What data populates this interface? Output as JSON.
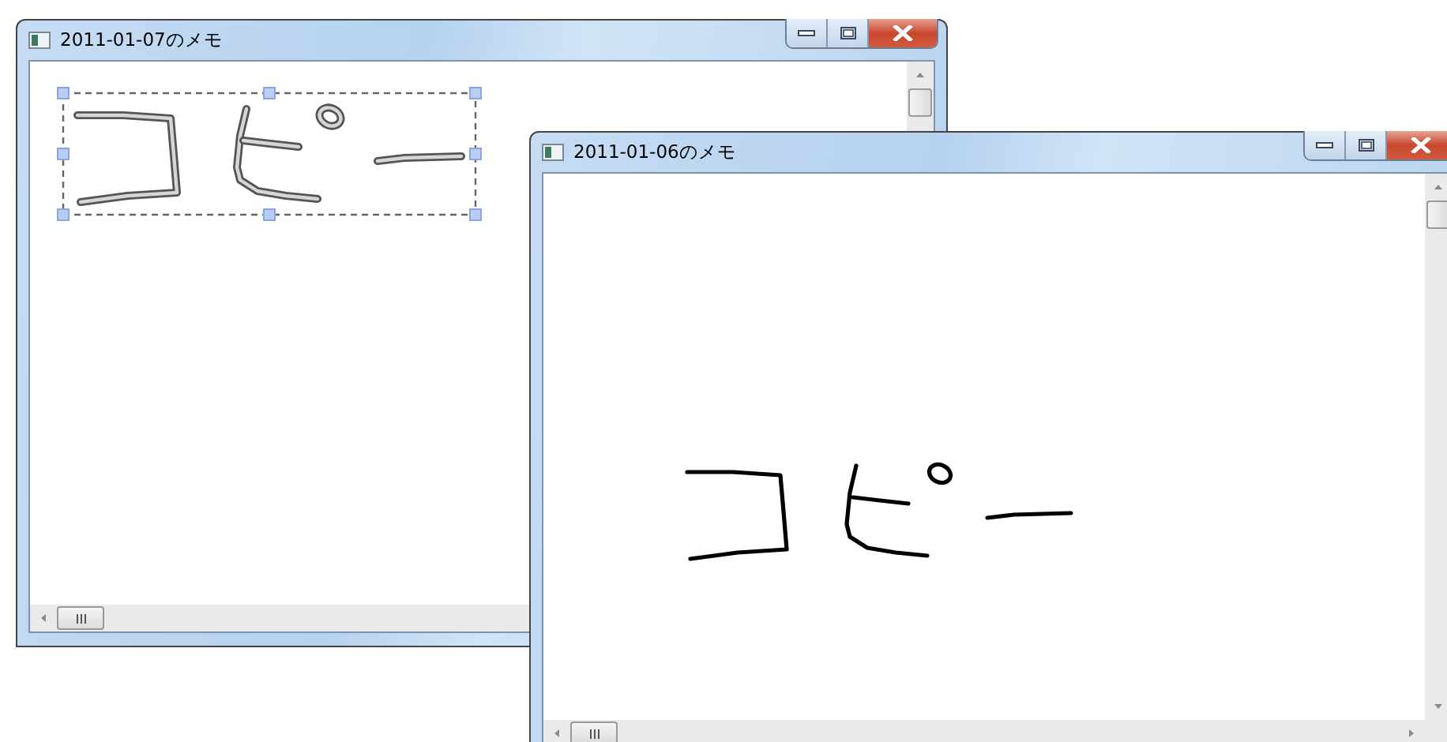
{
  "windows": [
    {
      "title": "2011-01-07のメモ",
      "ink_selected": true
    },
    {
      "title": "2011-01-06のメモ",
      "ink_selected": false
    }
  ]
}
